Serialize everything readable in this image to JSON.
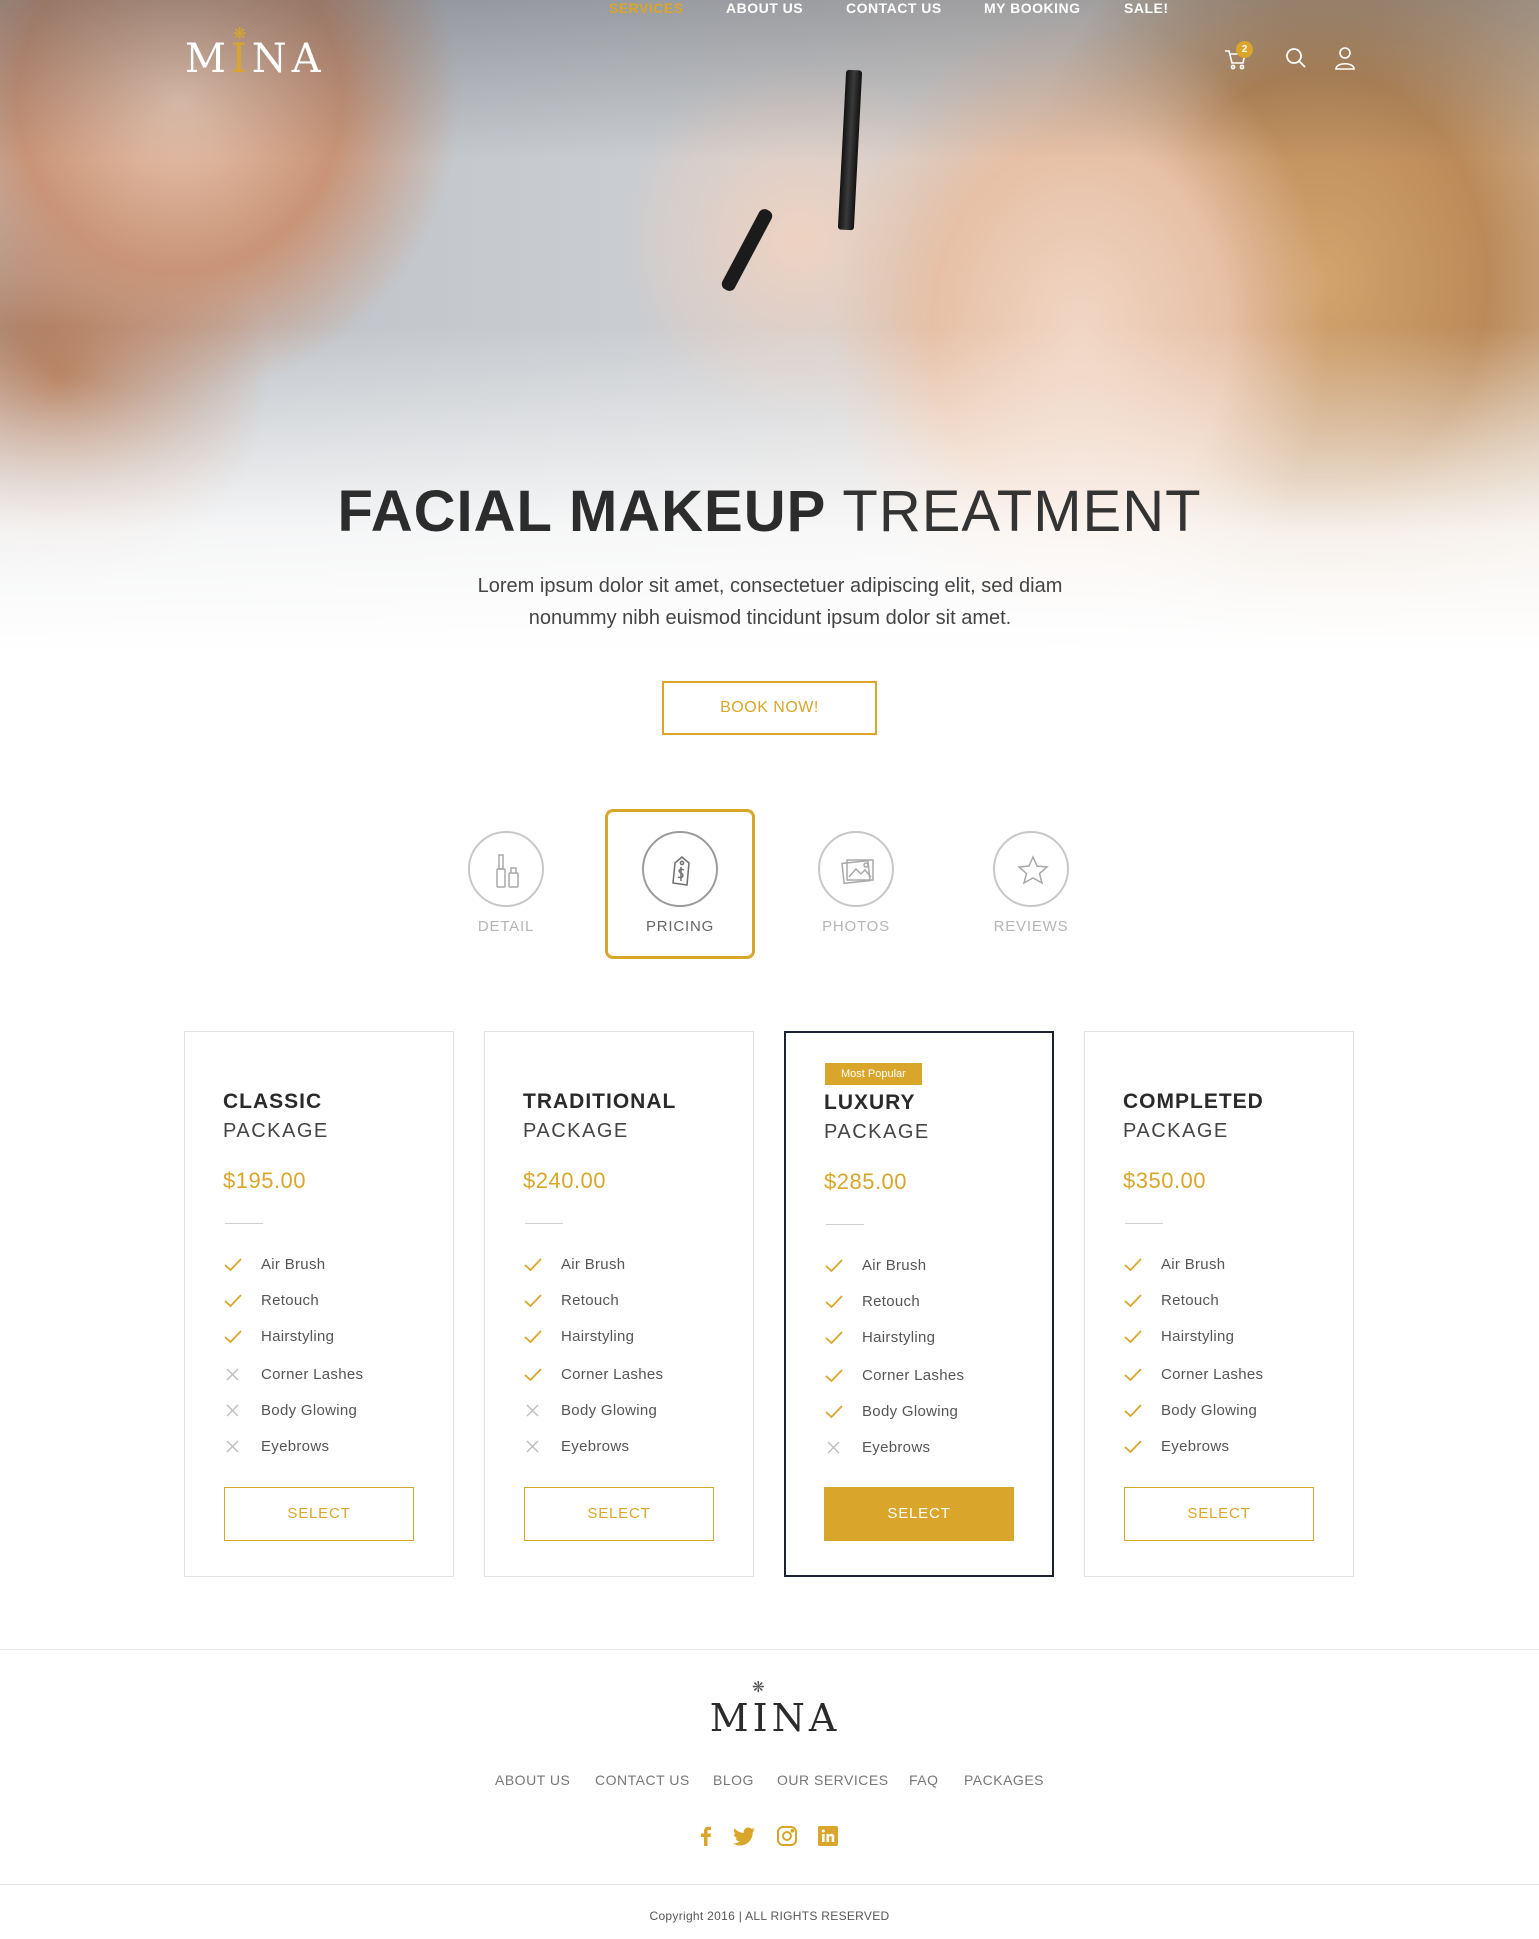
{
  "brand": {
    "logo_text": "MINA",
    "accent": "#d9a62b",
    "dark": "#1d2233"
  },
  "nav": {
    "items": [
      {
        "label": "SERVICES",
        "active": true
      },
      {
        "label": "ABOUT US",
        "active": false
      },
      {
        "label": "CONTACT US",
        "active": false
      },
      {
        "label": "MY BOOKING",
        "active": false
      },
      {
        "label": "SALE!",
        "active": false
      }
    ],
    "cart_count": "2",
    "icons": [
      "cart-icon",
      "search-icon",
      "user-icon"
    ]
  },
  "hero": {
    "title_bold": "FACIAL MAKEUP",
    "title_light": "TREATMENT",
    "description_line1": "Lorem ipsum dolor sit amet, consectetuer adipiscing elit, sed diam",
    "description_line2": "nonummy nibh euismod tincidunt ipsum dolor sit amet.",
    "cta_label": "BOOK NOW!"
  },
  "tabs": [
    {
      "label": "DETAIL",
      "icon": "mascara-icon",
      "active": false
    },
    {
      "label": "PRICING",
      "icon": "price-tag-icon",
      "active": true
    },
    {
      "label": "PHOTOS",
      "icon": "photos-icon",
      "active": false
    },
    {
      "label": "REVIEWS",
      "icon": "star-icon",
      "active": false
    }
  ],
  "packages": [
    {
      "name": "CLASSIC",
      "sub": "PACKAGE",
      "price": "$195.00",
      "badge": "",
      "featured": false,
      "select_label": "SELECT",
      "features": [
        {
          "label": "Air Brush",
          "included": true
        },
        {
          "label": "Retouch",
          "included": true
        },
        {
          "label": "Hairstyling",
          "included": true
        },
        {
          "label": "Corner Lashes",
          "included": false
        },
        {
          "label": "Body Glowing",
          "included": false
        },
        {
          "label": "Eyebrows",
          "included": false
        }
      ]
    },
    {
      "name": "TRADITIONAL",
      "sub": "PACKAGE",
      "price": "$240.00",
      "badge": "",
      "featured": false,
      "select_label": "SELECT",
      "features": [
        {
          "label": "Air Brush",
          "included": true
        },
        {
          "label": "Retouch",
          "included": true
        },
        {
          "label": "Hairstyling",
          "included": true
        },
        {
          "label": "Corner Lashes",
          "included": true
        },
        {
          "label": "Body Glowing",
          "included": false
        },
        {
          "label": "Eyebrows",
          "included": false
        }
      ]
    },
    {
      "name": "LUXURY",
      "sub": "PACKAGE",
      "price": "$285.00",
      "badge": "Most Popular",
      "featured": true,
      "select_label": "SELECT",
      "features": [
        {
          "label": "Air Brush",
          "included": true
        },
        {
          "label": "Retouch",
          "included": true
        },
        {
          "label": "Hairstyling",
          "included": true
        },
        {
          "label": "Corner Lashes",
          "included": true
        },
        {
          "label": "Body Glowing",
          "included": true
        },
        {
          "label": "Eyebrows",
          "included": false
        }
      ]
    },
    {
      "name": "COMPLETED",
      "sub": "PACKAGE",
      "price": "$350.00",
      "badge": "",
      "featured": false,
      "select_label": "SELECT",
      "features": [
        {
          "label": "Air Brush",
          "included": true
        },
        {
          "label": "Retouch",
          "included": true
        },
        {
          "label": "Hairstyling",
          "included": true
        },
        {
          "label": "Corner Lashes",
          "included": true
        },
        {
          "label": "Body Glowing",
          "included": true
        },
        {
          "label": "Eyebrows",
          "included": true
        }
      ]
    }
  ],
  "footer": {
    "logo_text": "MINA",
    "links": [
      "ABOUT US",
      "CONTACT US",
      "BLOG",
      "OUR SERVICES",
      "FAQ",
      "PACKAGES"
    ],
    "social": [
      "facebook-icon",
      "twitter-icon",
      "instagram-icon",
      "linkedin-icon"
    ],
    "copyright": "Copyright 2016 | ALL RIGHTS RESERVED"
  }
}
